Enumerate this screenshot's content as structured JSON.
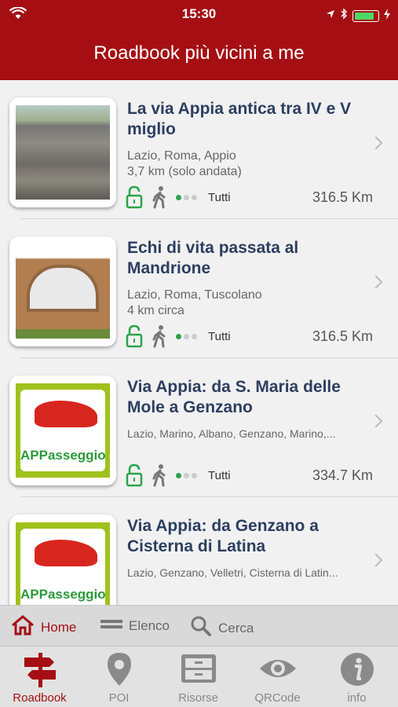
{
  "status": {
    "time": "15:30"
  },
  "header": {
    "title": "Roadbook più vicini a me"
  },
  "items": [
    {
      "title": "La via Appia antica tra IV e V miglio",
      "location": "Lazio, Roma, Appio",
      "detail": "3,7 km (solo andata)",
      "audience": "Tutti",
      "distance": "316.5 Km",
      "thumb": "road-photo"
    },
    {
      "title": "Echi di vita passata al Mandrione",
      "location": "Lazio, Roma, Tuscolano",
      "detail": "4 km circa",
      "audience": "Tutti",
      "distance": "316.5 Km",
      "thumb": "arch-photo"
    },
    {
      "title": "Via Appia: da S. Maria delle Mole a Genzano",
      "location": "Lazio, Marino, Albano, Genzano, Marino,...",
      "detail": "",
      "audience": "Tutti",
      "distance": "334.7 Km",
      "thumb": "appasseggio-logo",
      "thumb_text": "APPasseggio"
    },
    {
      "title": "Via Appia: da Genzano a Cisterna di Latina",
      "location": "Lazio, Genzano, Velletri, Cisterna di Latin...",
      "detail": "",
      "audience": "",
      "distance": "",
      "thumb": "appasseggio-logo",
      "thumb_text": "APPasseggio"
    }
  ],
  "filters": {
    "home": "Home",
    "elenco": "Elenco",
    "cerca": "Cerca"
  },
  "tabs": {
    "roadbook": "Roadbook",
    "poi": "POI",
    "risorse": "Risorse",
    "qrcode": "QRCode",
    "info": "info"
  },
  "colors": {
    "brand": "#a50f13",
    "title": "#2c3e60",
    "green": "#2ca34a"
  }
}
